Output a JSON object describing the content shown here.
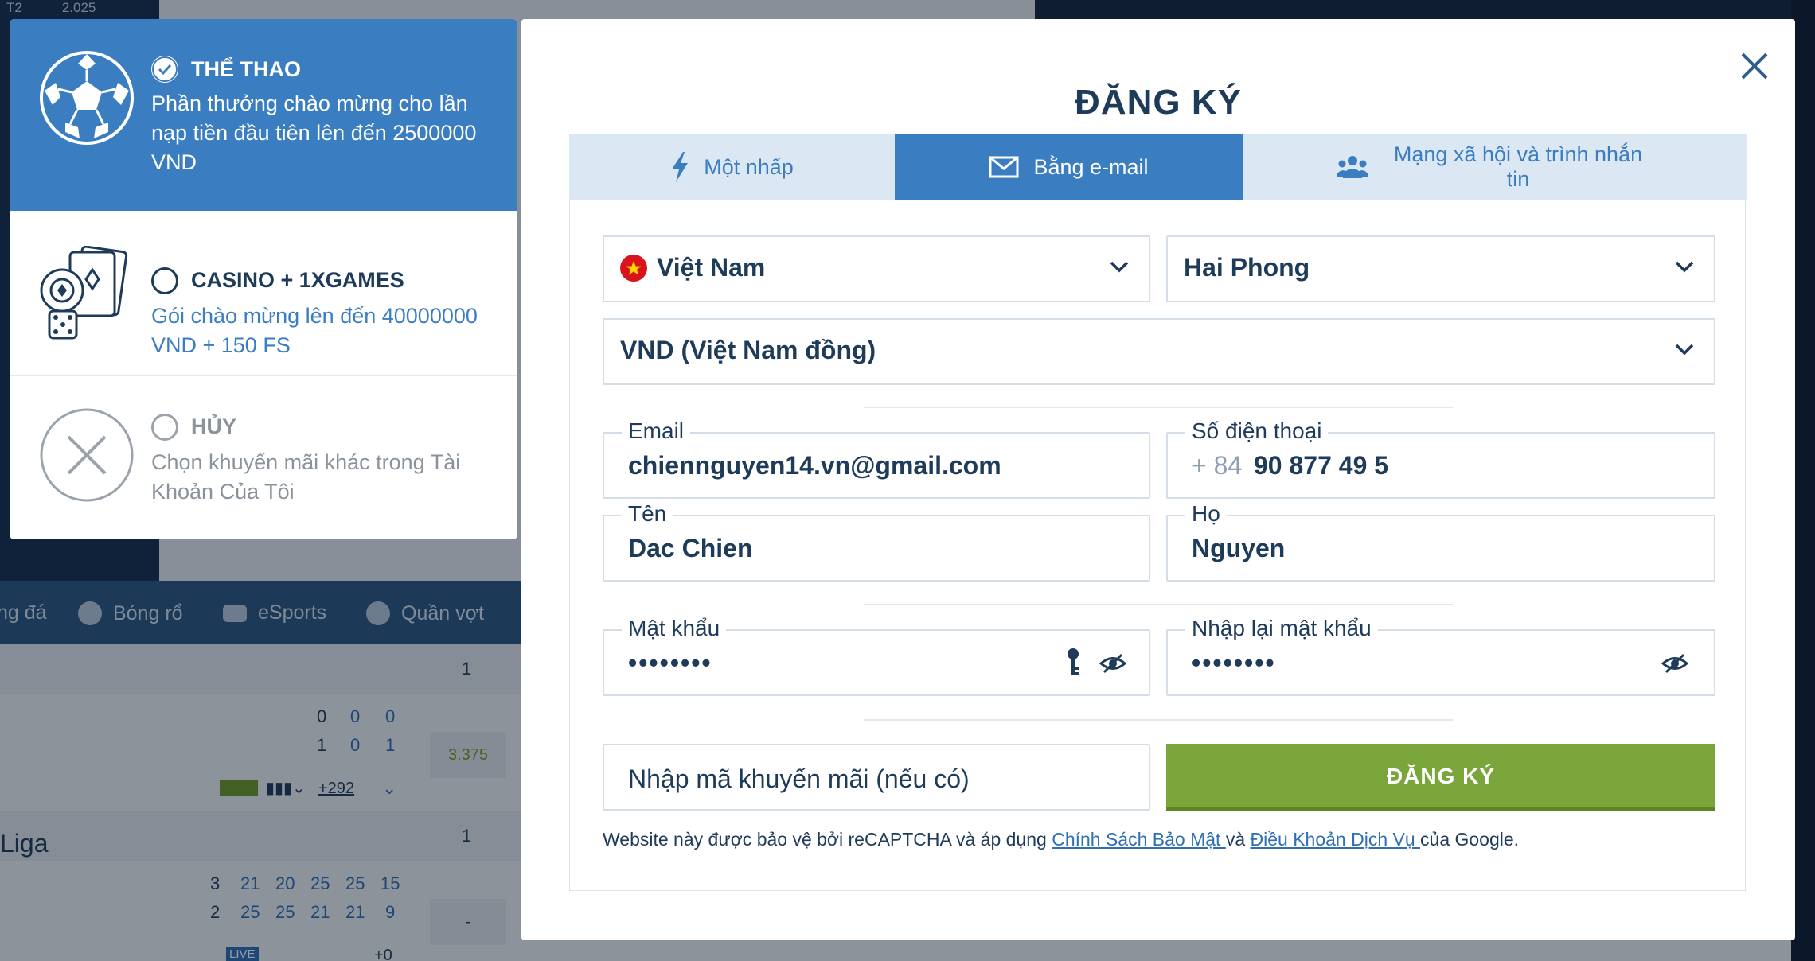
{
  "background": {
    "ticker": [
      "T2",
      "2.025"
    ],
    "sports": [
      {
        "label": "ng đá"
      },
      {
        "label": "Bóng rổ"
      },
      {
        "label": "eSports"
      },
      {
        "label": "Quần vợt"
      }
    ],
    "table": {
      "head_col": "1",
      "row1_scores": [
        "0",
        "0",
        "0"
      ],
      "row2_scores": [
        "1",
        "0",
        "1"
      ],
      "odd": "3.375",
      "more": "+292",
      "league": "Liga",
      "league_col": "1",
      "row3_scores": [
        "3",
        "21",
        "20",
        "25",
        "25",
        "15"
      ],
      "row4_scores": [
        "2",
        "25",
        "25",
        "21",
        "21",
        "9"
      ],
      "odd2": "-",
      "live": "LIVE",
      "more2": "+0"
    }
  },
  "bonuses": [
    {
      "id": "sport",
      "title": "THỂ THAO",
      "description": "Phần thưởng chào mừng cho lần nạp tiền đầu tiên lên đến 2500000 VND",
      "selected": true,
      "icon": "soccer-ball-icon"
    },
    {
      "id": "casino",
      "title": "CASINO + 1XGAMES",
      "description": "Gói chào mừng lên đến 40000000 VND + 150 FS",
      "selected": false,
      "icon": "casino-chips-cards-dice-icon"
    },
    {
      "id": "cancel",
      "title": "HỦY",
      "description": "Chọn khuyến mãi khác trong Tài Khoản Của Tôi",
      "selected": false,
      "icon": "cancel-x-icon"
    }
  ],
  "modal": {
    "title": "ĐĂNG KÝ",
    "tabs": [
      {
        "label": "Một nhấp",
        "icon": "lightning-icon",
        "active": false
      },
      {
        "label": "Bằng e-mail",
        "icon": "envelope-icon",
        "active": true
      },
      {
        "label": "Mạng xã hội và trình nhắn tin",
        "icon": "people-icon",
        "active": false
      }
    ],
    "country": "Việt Nam",
    "city": "Hai Phong",
    "currency": "VND (Việt Nam đồng)",
    "email": {
      "label": "Email",
      "value": "chiennguyen14.vn@gmail.com"
    },
    "phone": {
      "label": "Số điện thoại",
      "prefix": "+ 84",
      "value": "90 877 49 5"
    },
    "first_name": {
      "label": "Tên",
      "value": "Dac Chien"
    },
    "last_name": {
      "label": "Họ",
      "value": "Nguyen"
    },
    "password": {
      "label": "Mật khẩu",
      "value": "••••••••"
    },
    "password_confirm": {
      "label": "Nhập lại mật khẩu",
      "value": "••••••••"
    },
    "promo_placeholder": "Nhập mã khuyến mãi (nếu có)",
    "submit_label": "ĐĂNG KÝ",
    "recaptcha": {
      "prefix": "Website này được bảo vệ bởi reCAPTCHA và áp dụng ",
      "privacy_link": "Chính Sách Bảo Mật ",
      "and": "và ",
      "terms_link": "Điều Khoản Dịch Vụ ",
      "suffix": "của Google."
    },
    "colors": {
      "primary": "#3a7dc0",
      "tab_inactive": "#dbe7f2",
      "submit": "#79a53a",
      "text": "#1f3b5a"
    }
  }
}
